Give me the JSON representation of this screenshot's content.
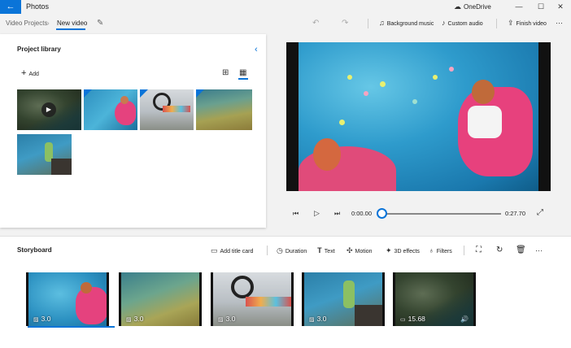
{
  "app": {
    "title": "Photos",
    "cloud_label": "OneDrive"
  },
  "window_controls": {
    "minimize": "—",
    "maximize": "☐",
    "close": "✕"
  },
  "breadcrumb": {
    "parent": "Video Projects",
    "current": "New video"
  },
  "commands": {
    "undo": "↶",
    "redo": "↷",
    "background_music": "Background music",
    "custom_audio": "Custom audio",
    "finish_video": "Finish video",
    "more": "···"
  },
  "library": {
    "title": "Project library",
    "add_label": "Add",
    "collapse_icon": "chevron-left-icon",
    "thumbnails": [
      {
        "kind": "video",
        "scene": "aerial-forest"
      },
      {
        "kind": "photo",
        "scene": "pool-float"
      },
      {
        "kind": "photo",
        "scene": "bmx-jump"
      },
      {
        "kind": "photo",
        "scene": "beach-shore"
      },
      {
        "kind": "photo",
        "scene": "cliff-lake"
      }
    ]
  },
  "player": {
    "current_time": "0:00.00",
    "duration": "0:27.70",
    "progress": 0.0
  },
  "storyboard": {
    "title": "Storyboard",
    "add_title_card": "Add title card",
    "duration": "Duration",
    "text": "Text",
    "motion": "Motion",
    "effects_3d": "3D effects",
    "filters": "Filters",
    "more": "···",
    "clips": [
      {
        "label": "3.0",
        "kind": "photo",
        "selected": true
      },
      {
        "label": "3.0",
        "kind": "photo",
        "selected": false
      },
      {
        "label": "3.0",
        "kind": "photo",
        "selected": false
      },
      {
        "label": "3.0",
        "kind": "photo",
        "selected": false
      },
      {
        "label": "15.68",
        "kind": "video",
        "selected": false
      }
    ]
  },
  "colors": {
    "accent": "#0a74d8"
  }
}
